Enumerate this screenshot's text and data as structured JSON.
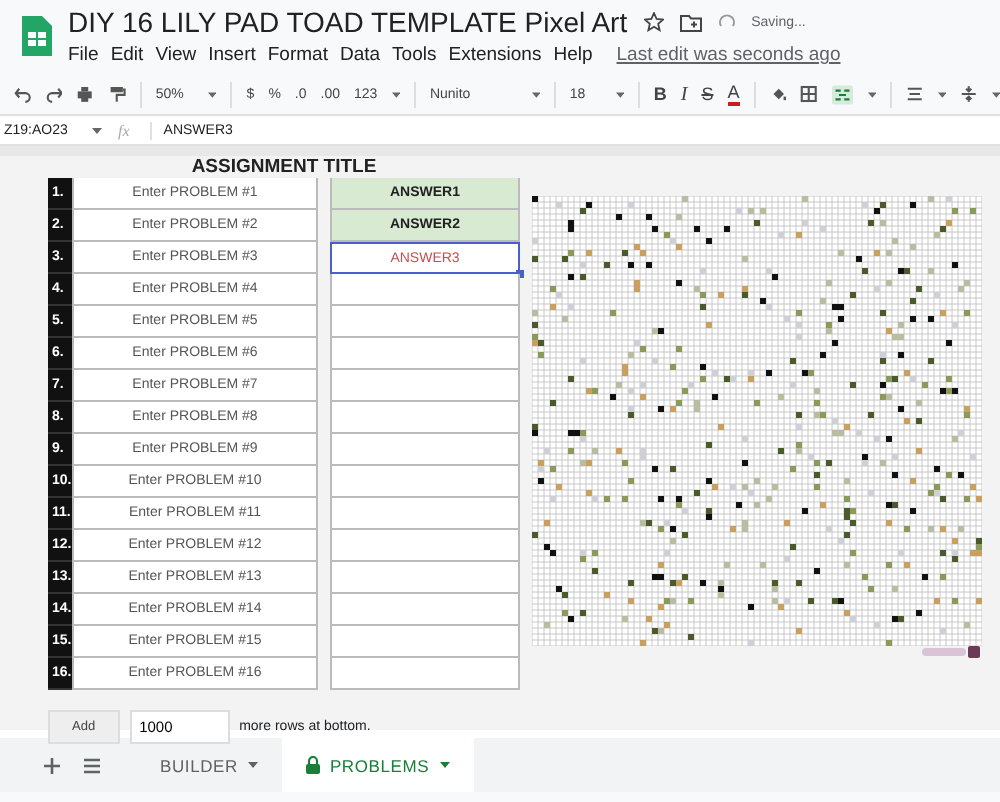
{
  "document": {
    "title": "DIY 16 LILY PAD TOAD TEMPLATE Pixel Art",
    "save_status": "Saving..."
  },
  "menu": [
    "File",
    "Edit",
    "View",
    "Insert",
    "Format",
    "Data",
    "Tools",
    "Extensions",
    "Help"
  ],
  "last_edit": "Last edit was seconds ago",
  "toolbar": {
    "zoom": "50%",
    "currency": "$",
    "percent": "%",
    "decrease_decimals": ".0",
    "increase_decimals": ".00",
    "number_format": "123",
    "font": "Nunito",
    "font_size": "18",
    "bold": "B",
    "italic": "I",
    "strikethrough": "S",
    "text_color": "A"
  },
  "formula_bar": {
    "name_box": "Z19:AO23",
    "fx": "fx",
    "value": "ANSWER3"
  },
  "sheet": {
    "title": "ASSIGNMENT TITLE",
    "rows": [
      {
        "number": "1.",
        "problem": "Enter PROBLEM #1",
        "answer": "ANSWER1",
        "correct": true,
        "selected": false
      },
      {
        "number": "2.",
        "problem": "Enter PROBLEM #2",
        "answer": "ANSWER2",
        "correct": true,
        "selected": false
      },
      {
        "number": "3.",
        "problem": "Enter PROBLEM #3",
        "answer": "ANSWER3",
        "correct": false,
        "selected": true
      },
      {
        "number": "4.",
        "problem": "Enter PROBLEM #4",
        "selected": false
      },
      {
        "number": "5.",
        "problem": "Enter PROBLEM #5",
        "selected": false
      },
      {
        "number": "6.",
        "problem": "Enter PROBLEM #6",
        "selected": false
      },
      {
        "number": "7.",
        "problem": "Enter PROBLEM #7",
        "selected": false
      },
      {
        "number": "8.",
        "problem": "Enter PROBLEM #8",
        "selected": false
      },
      {
        "number": "9.",
        "problem": "Enter PROBLEM #9",
        "selected": false
      },
      {
        "number": "10.",
        "problem": "Enter PROBLEM #10",
        "selected": false
      },
      {
        "number": "11.",
        "problem": "Enter PROBLEM #11",
        "selected": false
      },
      {
        "number": "12.",
        "problem": "Enter PROBLEM #12",
        "selected": false
      },
      {
        "number": "13.",
        "problem": "Enter PROBLEM #13",
        "selected": false
      },
      {
        "number": "14.",
        "problem": "Enter PROBLEM #14",
        "selected": false
      },
      {
        "number": "15.",
        "problem": "Enter PROBLEM #15",
        "selected": false
      },
      {
        "number": "16.",
        "problem": "Enter PROBLEM #16",
        "selected": false
      }
    ],
    "add_rows": {
      "button": "Add",
      "value": "1000",
      "suffix": "more rows at bottom."
    }
  },
  "sheet_tabs": [
    {
      "label": "BUILDER",
      "selected": false,
      "locked": false
    },
    {
      "label": "PROBLEMS",
      "selected": true,
      "locked": true
    }
  ]
}
